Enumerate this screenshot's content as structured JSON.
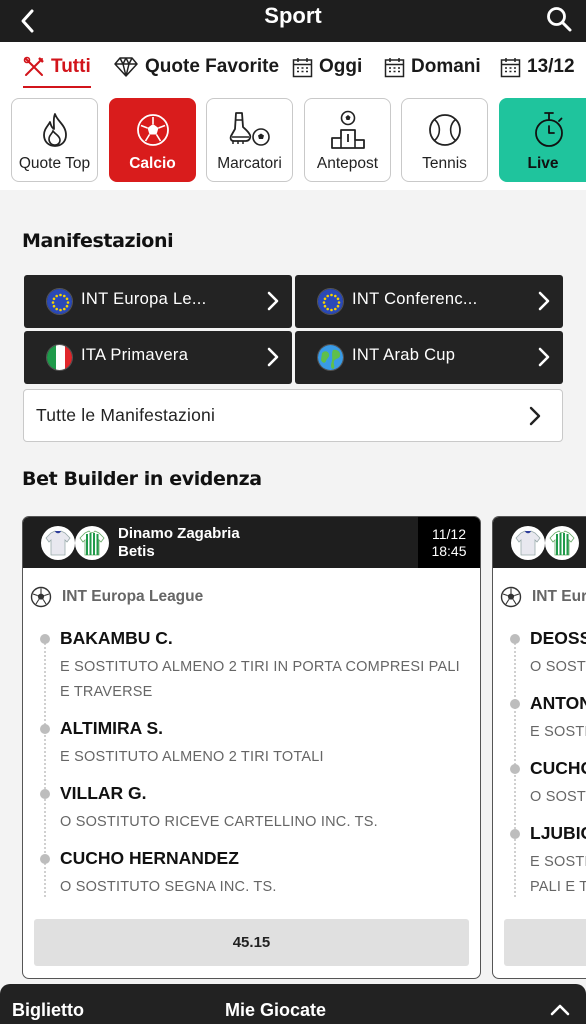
{
  "header": {
    "title": "Sport"
  },
  "tabs": [
    {
      "label": "Tutti",
      "icon": "tools-icon",
      "active": true
    },
    {
      "label": "Quote Favorite",
      "icon": "diamond-icon"
    },
    {
      "label": "Oggi",
      "icon": "calendar-icon"
    },
    {
      "label": "Domani",
      "icon": "calendar-icon"
    },
    {
      "label": "13/12",
      "icon": "calendar-icon"
    }
  ],
  "tiles": [
    {
      "label": "Quote Top",
      "icon": "flame-icon"
    },
    {
      "label": "Calcio",
      "icon": "soccer-ball-icon",
      "selected": true,
      "color": "#d91c1c"
    },
    {
      "label": "Marcatori",
      "icon": "boot-ball-icon"
    },
    {
      "label": "Antepost",
      "icon": "podium-icon"
    },
    {
      "label": "Tennis",
      "icon": "tennis-ball-icon"
    },
    {
      "label": "Live",
      "icon": "stopwatch-icon",
      "color": "#1fc49d"
    }
  ],
  "manifestazioni": {
    "title": "Manifestazioni",
    "items": [
      {
        "label": "INT Europa Le...",
        "flag": "eu-flag-icon"
      },
      {
        "label": "INT Conferenc...",
        "flag": "eu-flag-icon"
      },
      {
        "label": "ITA Primavera",
        "flag": "italy-flag-icon"
      },
      {
        "label": "INT Arab Cup",
        "flag": "globe-icon"
      }
    ],
    "all_label": "Tutte le Manifestazioni"
  },
  "bet_builder": {
    "title": "Bet Builder in evidenza",
    "cards": [
      {
        "home": "Dinamo Zagabria",
        "away": "Betis",
        "date": "11/12",
        "time": "18:45",
        "competition": "INT Europa League",
        "selections": [
          {
            "name": "BAKAMBU C.",
            "desc": "E SOSTITUTO ALMENO 2 TIRI IN PORTA COMPRESI PALI E TRAVERSE"
          },
          {
            "name": "ALTIMIRA S.",
            "desc": "E SOSTITUTO ALMENO 2 TIRI TOTALI"
          },
          {
            "name": "VILLAR G.",
            "desc": "O SOSTITUTO RICEVE CARTELLINO INC. TS."
          },
          {
            "name": "CUCHO HERNANDEZ",
            "desc": "O SOSTITUTO SEGNA INC. TS."
          }
        ],
        "odds": "45.15"
      },
      {
        "competition": "INT Eur",
        "selections": [
          {
            "name": "DEOSS",
            "desc": "O SOST"
          },
          {
            "name": "ANTON",
            "desc": "E SOSTI"
          },
          {
            "name": "CUCHO",
            "desc": "O SOST"
          },
          {
            "name": "LJUBIC",
            "desc": "E SOSTI PALI E T"
          }
        ]
      }
    ]
  },
  "bottom_bar": {
    "left": "Biglietto",
    "center": "Mie Giocate"
  },
  "colors": {
    "brand_red": "#d2141b",
    "live_green": "#1fc49d",
    "dark": "#1e1e1e"
  }
}
